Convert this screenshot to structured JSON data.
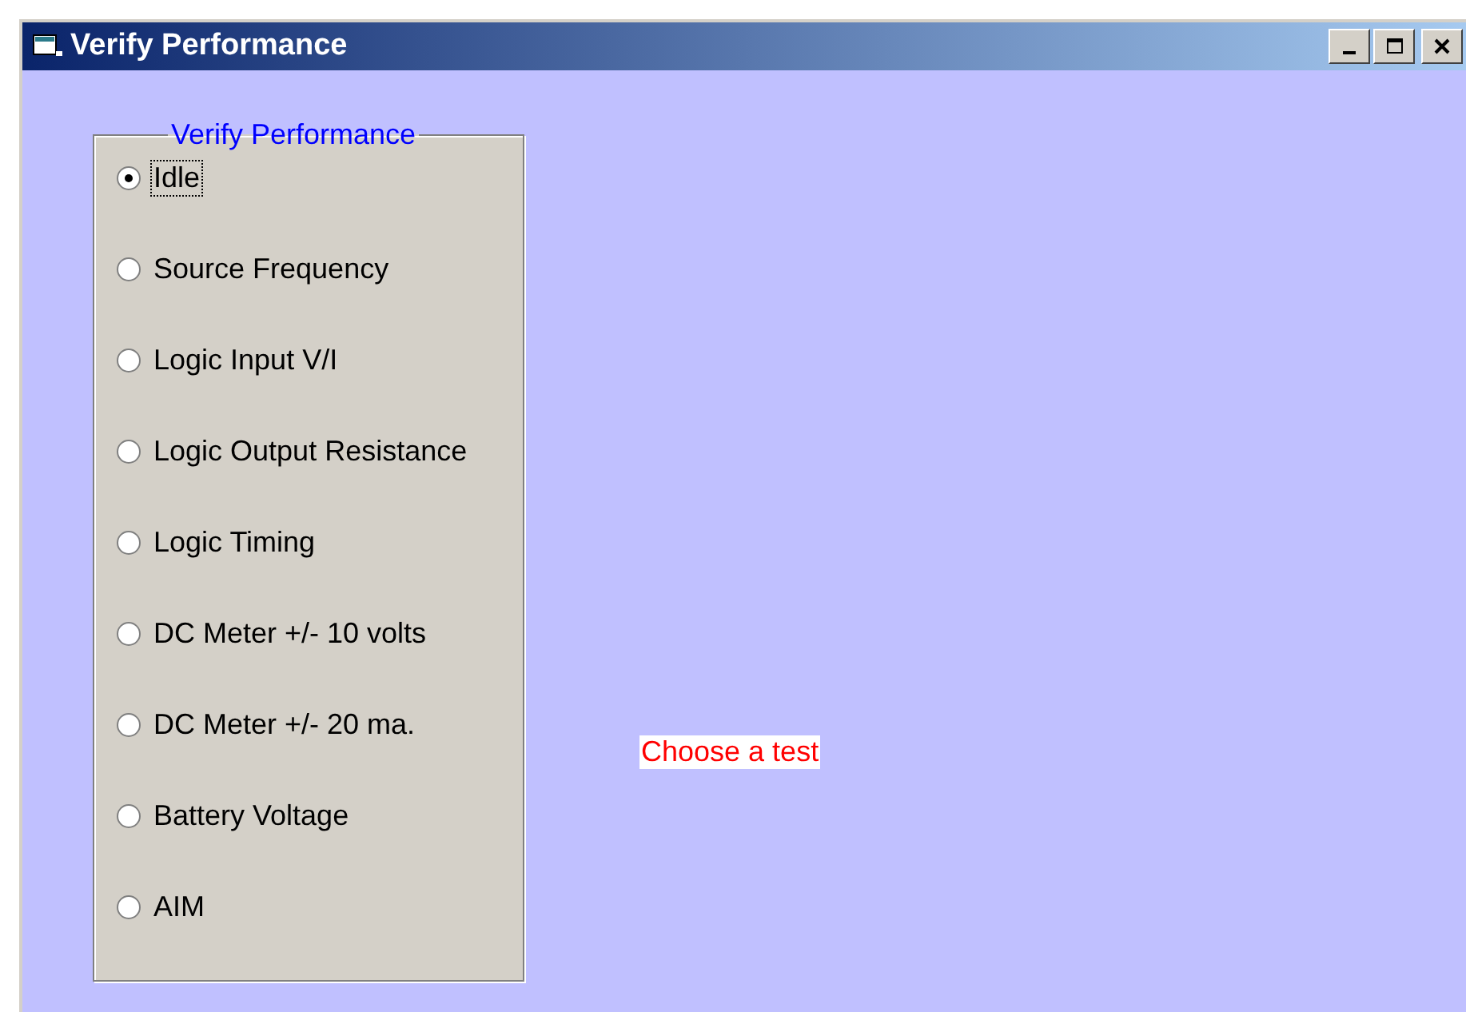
{
  "window": {
    "title": "Verify Performance"
  },
  "group": {
    "title": "Verify Performance",
    "options": [
      {
        "label": "Idle",
        "selected": true
      },
      {
        "label": "Source Frequency",
        "selected": false
      },
      {
        "label": "Logic Input V/I",
        "selected": false
      },
      {
        "label": "Logic Output Resistance",
        "selected": false
      },
      {
        "label": "Logic Timing",
        "selected": false
      },
      {
        "label": "DC Meter +/- 10 volts",
        "selected": false
      },
      {
        "label": "DC Meter +/- 20 ma.",
        "selected": false
      },
      {
        "label": "Battery Voltage",
        "selected": false
      },
      {
        "label": "AIM",
        "selected": false
      }
    ]
  },
  "status_label": "Choose a test"
}
